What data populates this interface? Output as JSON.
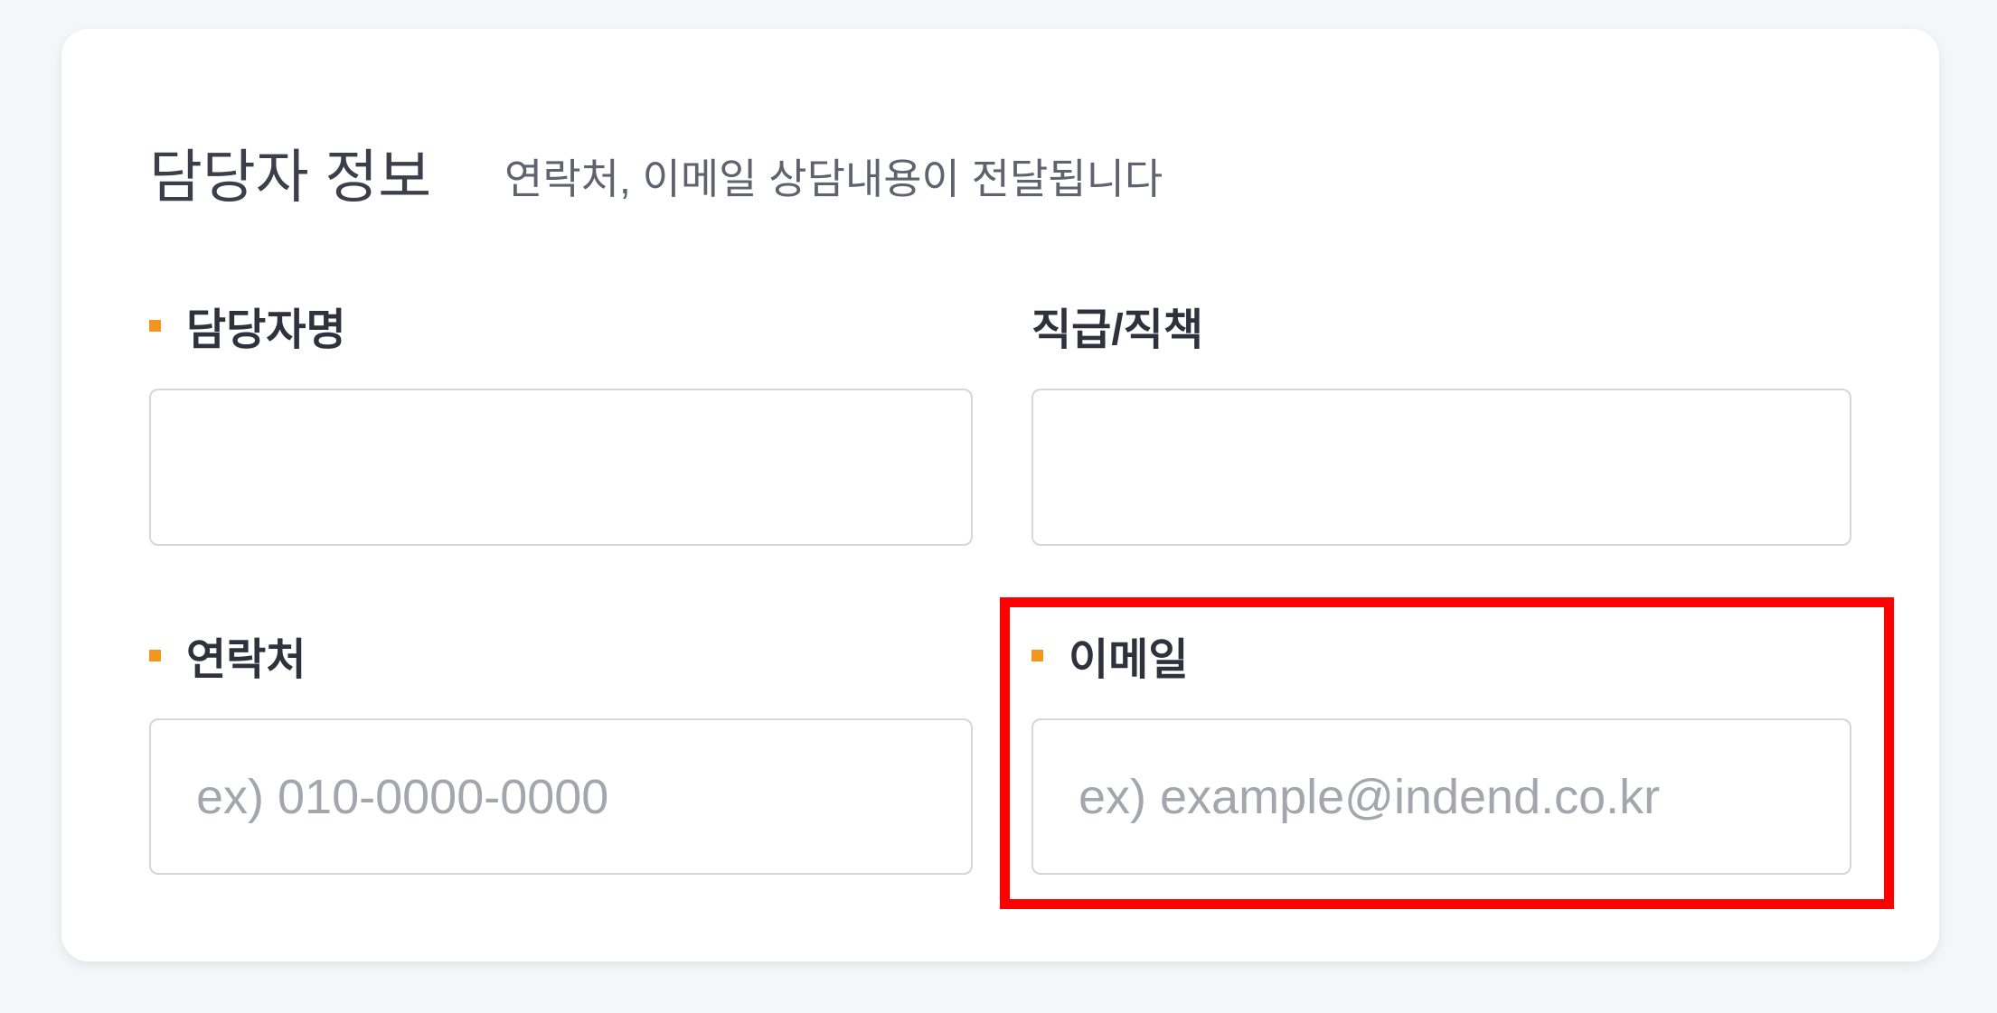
{
  "section": {
    "title": "담당자 정보",
    "subtitle": "연락처, 이메일 상담내용이 전달됩니다"
  },
  "fields": {
    "name": {
      "label": "담당자명",
      "required": true,
      "value": "",
      "placeholder": ""
    },
    "position": {
      "label": "직급/직책",
      "required": false,
      "value": "",
      "placeholder": ""
    },
    "phone": {
      "label": "연락처",
      "required": true,
      "value": "",
      "placeholder": "ex) 010-0000-0000"
    },
    "email": {
      "label": "이메일",
      "required": true,
      "value": "",
      "placeholder": "ex) example@indend.co.kr"
    }
  },
  "colors": {
    "required_marker": "#f7941d",
    "highlight": "#ff0000"
  }
}
